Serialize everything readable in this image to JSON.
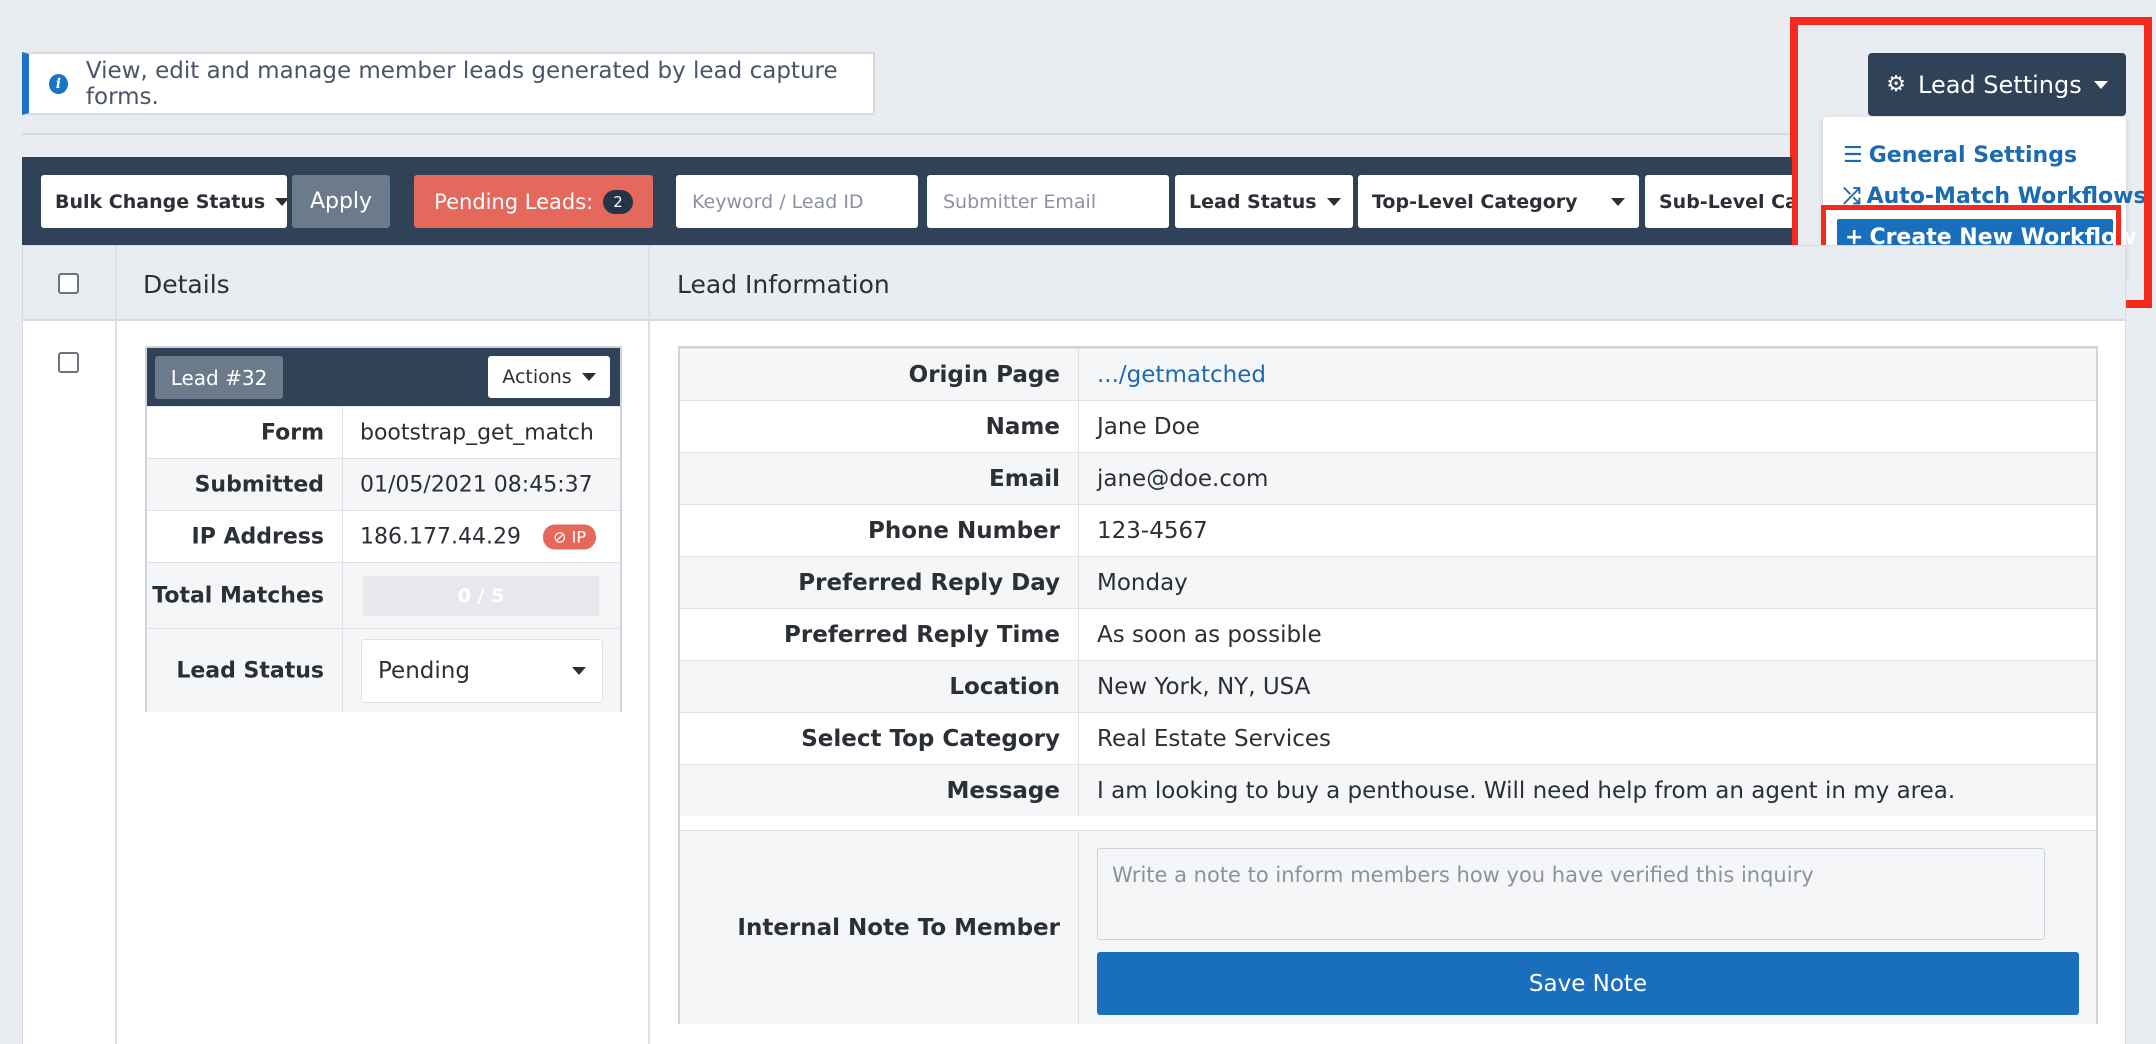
{
  "info_alert": {
    "text": "View, edit and manage member leads generated by lead capture forms."
  },
  "lead_settings": {
    "button_label": "Lead Settings",
    "menu": [
      {
        "icon": "sliders-icon",
        "label": "General Settings"
      },
      {
        "icon": "shuffle-icon",
        "label": "Auto-Match Workflows"
      },
      {
        "icon": "plus-icon",
        "label": "Create New Workflow"
      }
    ]
  },
  "toolbar": {
    "bulk_change_status": "Bulk Change Status",
    "apply": "Apply",
    "pending_leads_label": "Pending Leads:",
    "pending_leads_count": "2",
    "keyword_placeholder": "Keyword / Lead ID",
    "submitter_email_placeholder": "Submitter Email",
    "lead_status_filter": "Lead Status",
    "top_level_category": "Top-Level Category",
    "sub_level_category": "Sub-Level Category"
  },
  "table": {
    "headers": {
      "details": "Details",
      "lead_information": "Lead Information"
    }
  },
  "lead": {
    "badge": "Lead #32",
    "actions": "Actions",
    "details": {
      "form_label": "Form",
      "form_value": "bootstrap_get_match",
      "submitted_label": "Submitted",
      "submitted_value": "01/05/2021 08:45:37",
      "ip_label": "IP Address",
      "ip_value": "186.177.44.29",
      "ip_badge": "IP",
      "matches_label": "Total Matches",
      "matches_value": "0 / 5",
      "matches_fraction": 0,
      "status_label": "Lead Status",
      "status_value": "Pending"
    },
    "information": [
      {
        "label": "Origin Page",
        "value": ".../getmatched",
        "link": true
      },
      {
        "label": "Name",
        "value": "Jane Doe"
      },
      {
        "label": "Email",
        "value": "jane@doe.com"
      },
      {
        "label": "Phone Number",
        "value": "123-4567"
      },
      {
        "label": "Preferred Reply Day",
        "value": "Monday"
      },
      {
        "label": "Preferred Reply Time",
        "value": "As soon as possible"
      },
      {
        "label": "Location",
        "value": "New York, NY, USA"
      },
      {
        "label": "Select Top Category",
        "value": "Real Estate Services"
      },
      {
        "label": "Message",
        "value": "I am looking to buy a penthouse. Will need help from an agent in my area."
      }
    ],
    "internal_note": {
      "label": "Internal Note To Member",
      "placeholder": "Write a note to inform members how you have verified this inquiry",
      "save_button": "Save Note"
    }
  },
  "colors": {
    "primary": "#1a6fbd",
    "dark": "#2f4257",
    "danger": "#e4685c",
    "teal": "#17a398",
    "highlight": "#f32a1d"
  }
}
